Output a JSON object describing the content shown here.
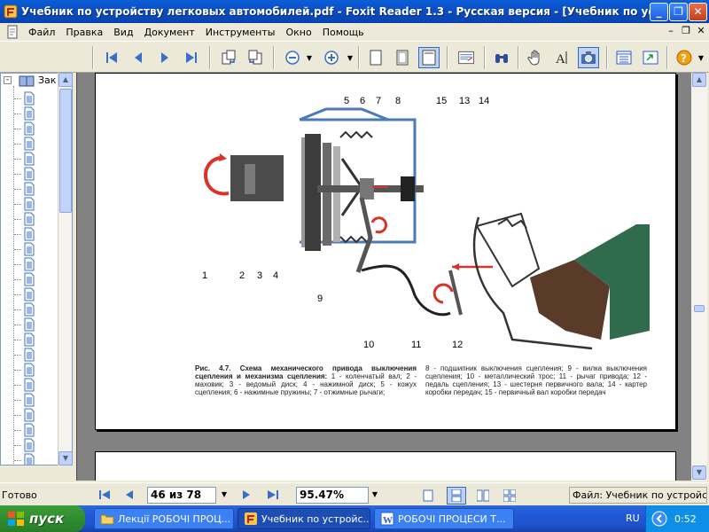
{
  "window": {
    "title": "Учебник по устройству легковых автомобилей.pdf - Foxit Reader 1.3 - Русская версия  - [Учебник по устро..."
  },
  "menu": {
    "items": [
      "Файл",
      "Правка",
      "Вид",
      "Документ",
      "Инструменты",
      "Окно",
      "Помощь"
    ]
  },
  "toolbar": {
    "buttons": [
      "first-page",
      "previous-page",
      "next-page",
      "last-page",
      "rotate-left",
      "rotate-right",
      "zoom-out",
      "zoom-in",
      "actual-size",
      "fit-page",
      "fit-width",
      "text-select",
      "find",
      "hand-tool",
      "select-text-tool",
      "snapshot",
      "bookmarks-panel",
      "thumbnails-panel",
      "help"
    ]
  },
  "bookmarks": {
    "root_label": "Зак"
  },
  "document": {
    "figure_numbers": [
      "1",
      "2",
      "3",
      "4",
      "5",
      "6",
      "7",
      "8",
      "9",
      "10",
      "11",
      "12",
      "13",
      "14",
      "15"
    ],
    "caption_left_bold": "Рис. 4.7. Схема механического привода выключения сцепления и механизма сцепления:",
    "caption_left_body": "1 - коленчатый вал; 2 - маховик; 3 - ведомый диск; 4 - нажимной диск; 5 - кожух сцепления; 6 - нажимные пружины; 7 - отжимные рычаги;",
    "caption_right": "8 - подшипник выключения сцепления; 9 - вилка выключения сцепления; 10 - металлический трос; 11 - рычаг привода; 12 - педаль сцепления; 13 - шестерня первичного вала; 14 - картер коробки передач; 15 - первичный вал коробки передач"
  },
  "statusbar": {
    "ready": "Готово",
    "page_field": "46 из 78",
    "zoom_field": "95.47%",
    "file_label": "Файл: Учебник по устройству"
  },
  "taskbar": {
    "start_label": "пуск",
    "tasks": [
      "Лекції РОБОЧІ ПРОЦ...",
      "Учебник по устройс...",
      "РОБОЧІ ПРОЦЕСИ Т..."
    ],
    "language": "RU",
    "clock": "0:52"
  },
  "colors": {
    "titlebar": "#0c4fc4",
    "doc_background": "#828282",
    "taskbar": "#245edb",
    "start_button": "#2f8d2f",
    "arrow_red": "#d8342a",
    "pedal_green": "#2f6b4c"
  }
}
